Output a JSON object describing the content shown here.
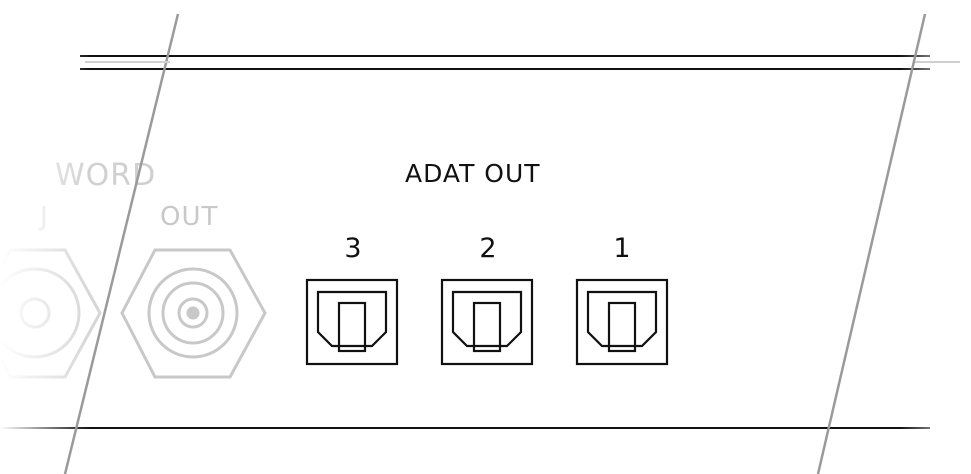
{
  "panel": {
    "section_label": "ADAT OUT",
    "word_label": "WORD",
    "out_label": "OUT",
    "ports": [
      {
        "number": "3"
      },
      {
        "number": "2"
      },
      {
        "number": "1"
      }
    ]
  },
  "colors": {
    "line": "#111111",
    "faded": "#c8c8c8",
    "edge": "#9a9a9a"
  }
}
